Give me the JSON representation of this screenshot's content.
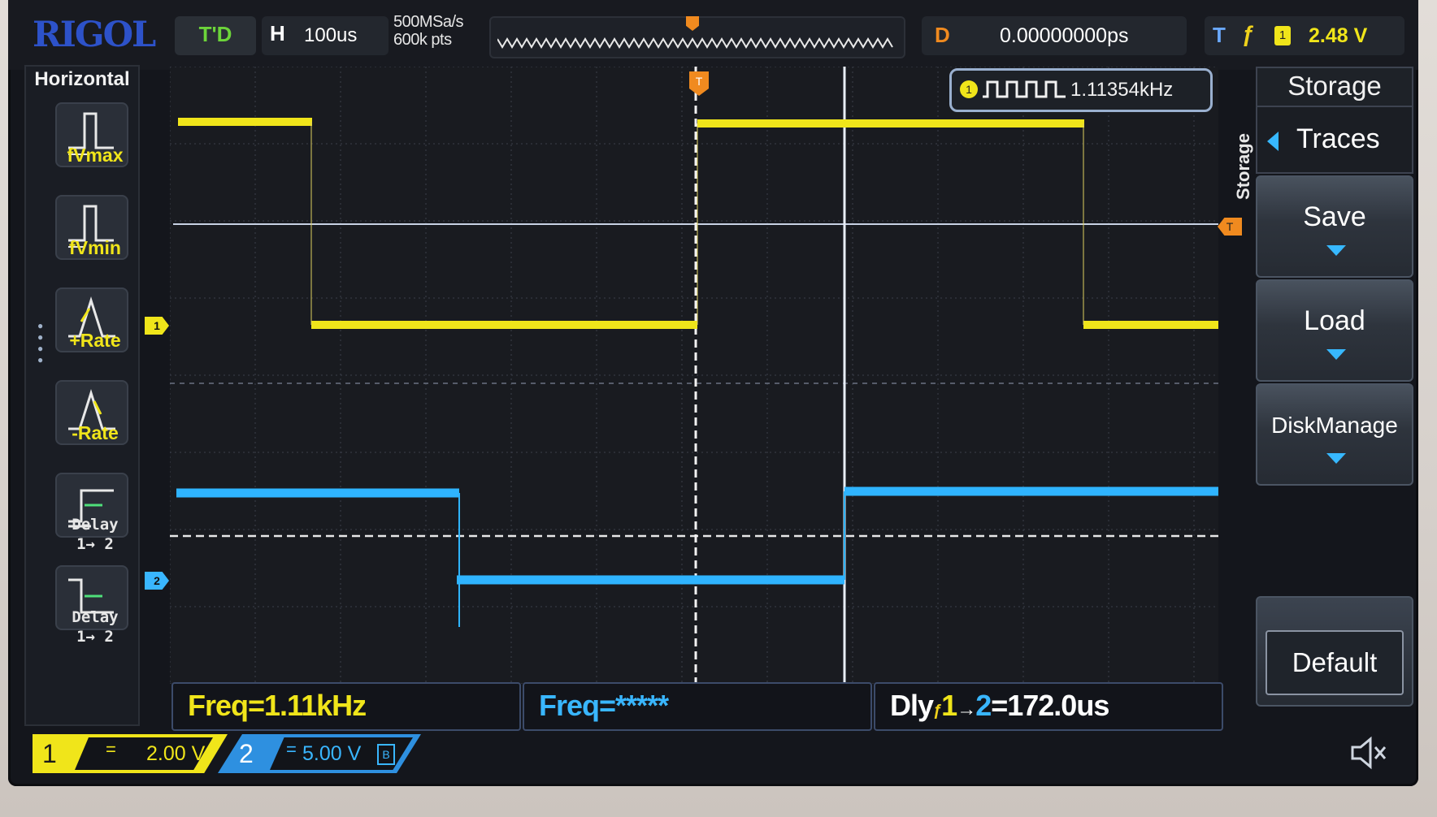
{
  "top": {
    "brand": "RIGOL",
    "run_state": "T'D",
    "horizontal_label": "H",
    "timebase": "100us",
    "sample_rate": "500MSa/s",
    "memory_depth": "600k pts",
    "delay_label": "D",
    "delay_value": "0.00000000ps",
    "trigger_label": "T",
    "trigger_source": "1",
    "trigger_level": "2.48 V"
  },
  "left_menu": {
    "title": "Horizontal",
    "items": [
      {
        "label": "fVmax"
      },
      {
        "label": "fVmin"
      },
      {
        "label": "+Rate"
      },
      {
        "label": "-Rate"
      },
      {
        "label_top": "Delay",
        "label_bottom": "1→ 2"
      },
      {
        "label_top": "Delay",
        "label_bottom": "1→ 2"
      }
    ]
  },
  "right_menu": {
    "side_label": "Storage",
    "title": "Storage",
    "traces": "Traces",
    "buttons": [
      "Save",
      "Load",
      "DiskManage"
    ],
    "default": "Default"
  },
  "freq_counter": {
    "channel": "1",
    "value": "1.11354kHz"
  },
  "markers": {
    "trigger_top": "T",
    "trigger_level": "T",
    "ch1": "1",
    "ch2": "2"
  },
  "measurements": {
    "m1": "Freq=1.11kHz",
    "m2": "Freq=*****",
    "m3_prefix": "Dly",
    "m3_a": "1",
    "m3_arrow": "→",
    "m3_b": "2",
    "m3_value": "=172.0us"
  },
  "channels": {
    "ch1": {
      "number": "1",
      "coupling": "=",
      "scale": "2.00 V"
    },
    "ch2": {
      "number": "2",
      "coupling": "=",
      "scale": "5.00 V",
      "bw_limit": "B"
    }
  },
  "colors": {
    "ch1": "#f0e51a",
    "ch2": "#39b6ff",
    "trigger": "#f08a1f",
    "brand": "#2d52c9"
  },
  "icons": {
    "speaker": "speaker-muted-icon"
  }
}
